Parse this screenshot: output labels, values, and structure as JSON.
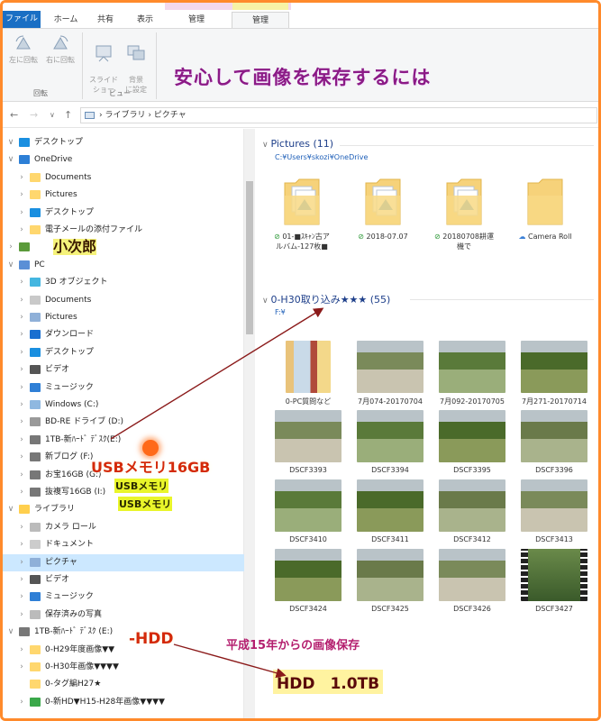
{
  "ribbon": {
    "tabs": [
      "ファイル",
      "ホーム",
      "共有",
      "表示",
      "管理",
      "管理"
    ],
    "buttons": [
      {
        "label": "左に回転",
        "icon": "rotate-left-icon"
      },
      {
        "label": "右に回転",
        "icon": "rotate-right-icon"
      },
      {
        "label": "スライド\nショー",
        "icon": "slideshow-icon"
      },
      {
        "label": "背景\nに設定",
        "icon": "set-background-icon"
      }
    ],
    "groups": [
      "回転",
      "ビュー"
    ]
  },
  "headline": "安心して画像を保存するには",
  "address": {
    "path": "› ライブラリ › ピクチャ"
  },
  "tree": [
    {
      "label": "デスクトップ",
      "chev": "v",
      "indent": 0,
      "color": "#1a8fe0"
    },
    {
      "label": "OneDrive",
      "chev": "v",
      "indent": 0,
      "color": "#2d7fd6"
    },
    {
      "label": "Documents",
      "chev": ">",
      "indent": 1,
      "color": "#ffd76e"
    },
    {
      "label": "Pictures",
      "chev": ">",
      "indent": 1,
      "color": "#ffd76e"
    },
    {
      "label": "デスクトップ",
      "chev": ">",
      "indent": 1,
      "color": "#1a8fe0"
    },
    {
      "label": "電子メールの添付ファイル",
      "chev": ">",
      "indent": 1,
      "color": "#ffd76e"
    },
    {
      "label": "小次郎",
      "chev": ">",
      "indent": 0,
      "color": "#5a9a3a"
    },
    {
      "label": "PC",
      "chev": "v",
      "indent": 0,
      "color": "#5b8fd6"
    },
    {
      "label": "3D オブジェクト",
      "chev": ">",
      "indent": 1,
      "color": "#44b6e0"
    },
    {
      "label": "Documents",
      "chev": ">",
      "indent": 1,
      "color": "#c9c9c9"
    },
    {
      "label": "Pictures",
      "chev": ">",
      "indent": 1,
      "color": "#8fb0d8"
    },
    {
      "label": "ダウンロード",
      "chev": ">",
      "indent": 1,
      "color": "#1a6fd0"
    },
    {
      "label": "デスクトップ",
      "chev": ">",
      "indent": 1,
      "color": "#1a8fe0"
    },
    {
      "label": "ビデオ",
      "chev": ">",
      "indent": 1,
      "color": "#555"
    },
    {
      "label": "ミュージック",
      "chev": ">",
      "indent": 1,
      "color": "#2f7fd6"
    },
    {
      "label": "Windows (C:)",
      "chev": ">",
      "indent": 1,
      "color": "#8fb8e0"
    },
    {
      "label": "BD-RE ドライブ (D:)",
      "chev": ">",
      "indent": 1,
      "color": "#999"
    },
    {
      "label": "1TB-新ﾊｰﾄﾞ ﾃﾞｽｸ(E:)",
      "chev": ">",
      "indent": 1,
      "color": "#777"
    },
    {
      "label": "新ブログ (F:)",
      "chev": ">",
      "indent": 1,
      "color": "#777"
    },
    {
      "label": "お宝16GB (G:)",
      "chev": ">",
      "indent": 1,
      "color": "#777"
    },
    {
      "label": "抜複写16GB (I:)",
      "chev": ">",
      "indent": 1,
      "color": "#777"
    },
    {
      "label": "ライブラリ",
      "chev": "v",
      "indent": 0,
      "color": "#ffcf4d"
    },
    {
      "label": "カメラ ロール",
      "chev": ">",
      "indent": 1,
      "color": "#bbb"
    },
    {
      "label": "ドキュメント",
      "chev": ">",
      "indent": 1,
      "color": "#ccc"
    },
    {
      "label": "ピクチャ",
      "chev": ">",
      "indent": 1,
      "color": "#8fb0d8",
      "selected": true
    },
    {
      "label": "ビデオ",
      "chev": ">",
      "indent": 1,
      "color": "#555"
    },
    {
      "label": "ミュージック",
      "chev": ">",
      "indent": 1,
      "color": "#2f7fd6"
    },
    {
      "label": "保存済みの写真",
      "chev": ">",
      "indent": 1,
      "color": "#bbb"
    },
    {
      "label": "1TB-新ﾊｰﾄﾞ ﾃﾞｽｸ (E:)",
      "chev": "v",
      "indent": 0,
      "color": "#777"
    },
    {
      "label": "0-H29年度画像▼▼",
      "chev": ">",
      "indent": 1,
      "color": "#ffd76e"
    },
    {
      "label": "0-H30年画像▼▼▼▼",
      "chev": ">",
      "indent": 1,
      "color": "#ffd76e"
    },
    {
      "label": "0-タグ編H27★",
      "chev": "",
      "indent": 1,
      "color": "#ffd76e"
    },
    {
      "label": "0-新HD▼H15-H28年画像▼▼▼▼",
      "chev": ">",
      "indent": 1,
      "color": "#3aa84a"
    }
  ],
  "sections": [
    {
      "title": "Pictures (11)",
      "path": "C:¥Users¥skozi¥OneDrive"
    },
    {
      "title": "0-H30取り込み★★★ (55)",
      "path": "F:¥"
    }
  ],
  "pictures_folders": [
    {
      "label": "01-■ｽｷｬﾝ古ア\nルバム-127枚■",
      "status": "synced-check-icon"
    },
    {
      "label": "2018-07.07",
      "status": "synced-check-icon"
    },
    {
      "label": "20180708耕運\n機で",
      "status": "synced-check-icon"
    },
    {
      "label": "Camera Roll",
      "status": "cloud-icon"
    }
  ],
  "photos": [
    "0-PC質問など",
    "7月074-20170704",
    "7月092-20170705",
    "7月271-20170714",
    "DSCF3393",
    "DSCF3394",
    "DSCF3395",
    "DSCF3396",
    "DSCF3410",
    "DSCF3411",
    "DSCF3412",
    "DSCF3413",
    "DSCF3424",
    "DSCF3425",
    "DSCF3426",
    "DSCF3427"
  ],
  "overlays": {
    "usb_big": "USBメモリ16GB",
    "usb_small_1": "USBメモリ",
    "usb_small_2": "USBメモリ",
    "hdd_left": "-HDD",
    "hdd_caption": "平成15年からの画像保存",
    "hdd_big": "HDD　1.0TB"
  },
  "colors": {
    "frame": "#ff8a2b",
    "headline": "#8b1a86",
    "selection": "#cce8ff",
    "arrow": "#8b1a1a"
  }
}
